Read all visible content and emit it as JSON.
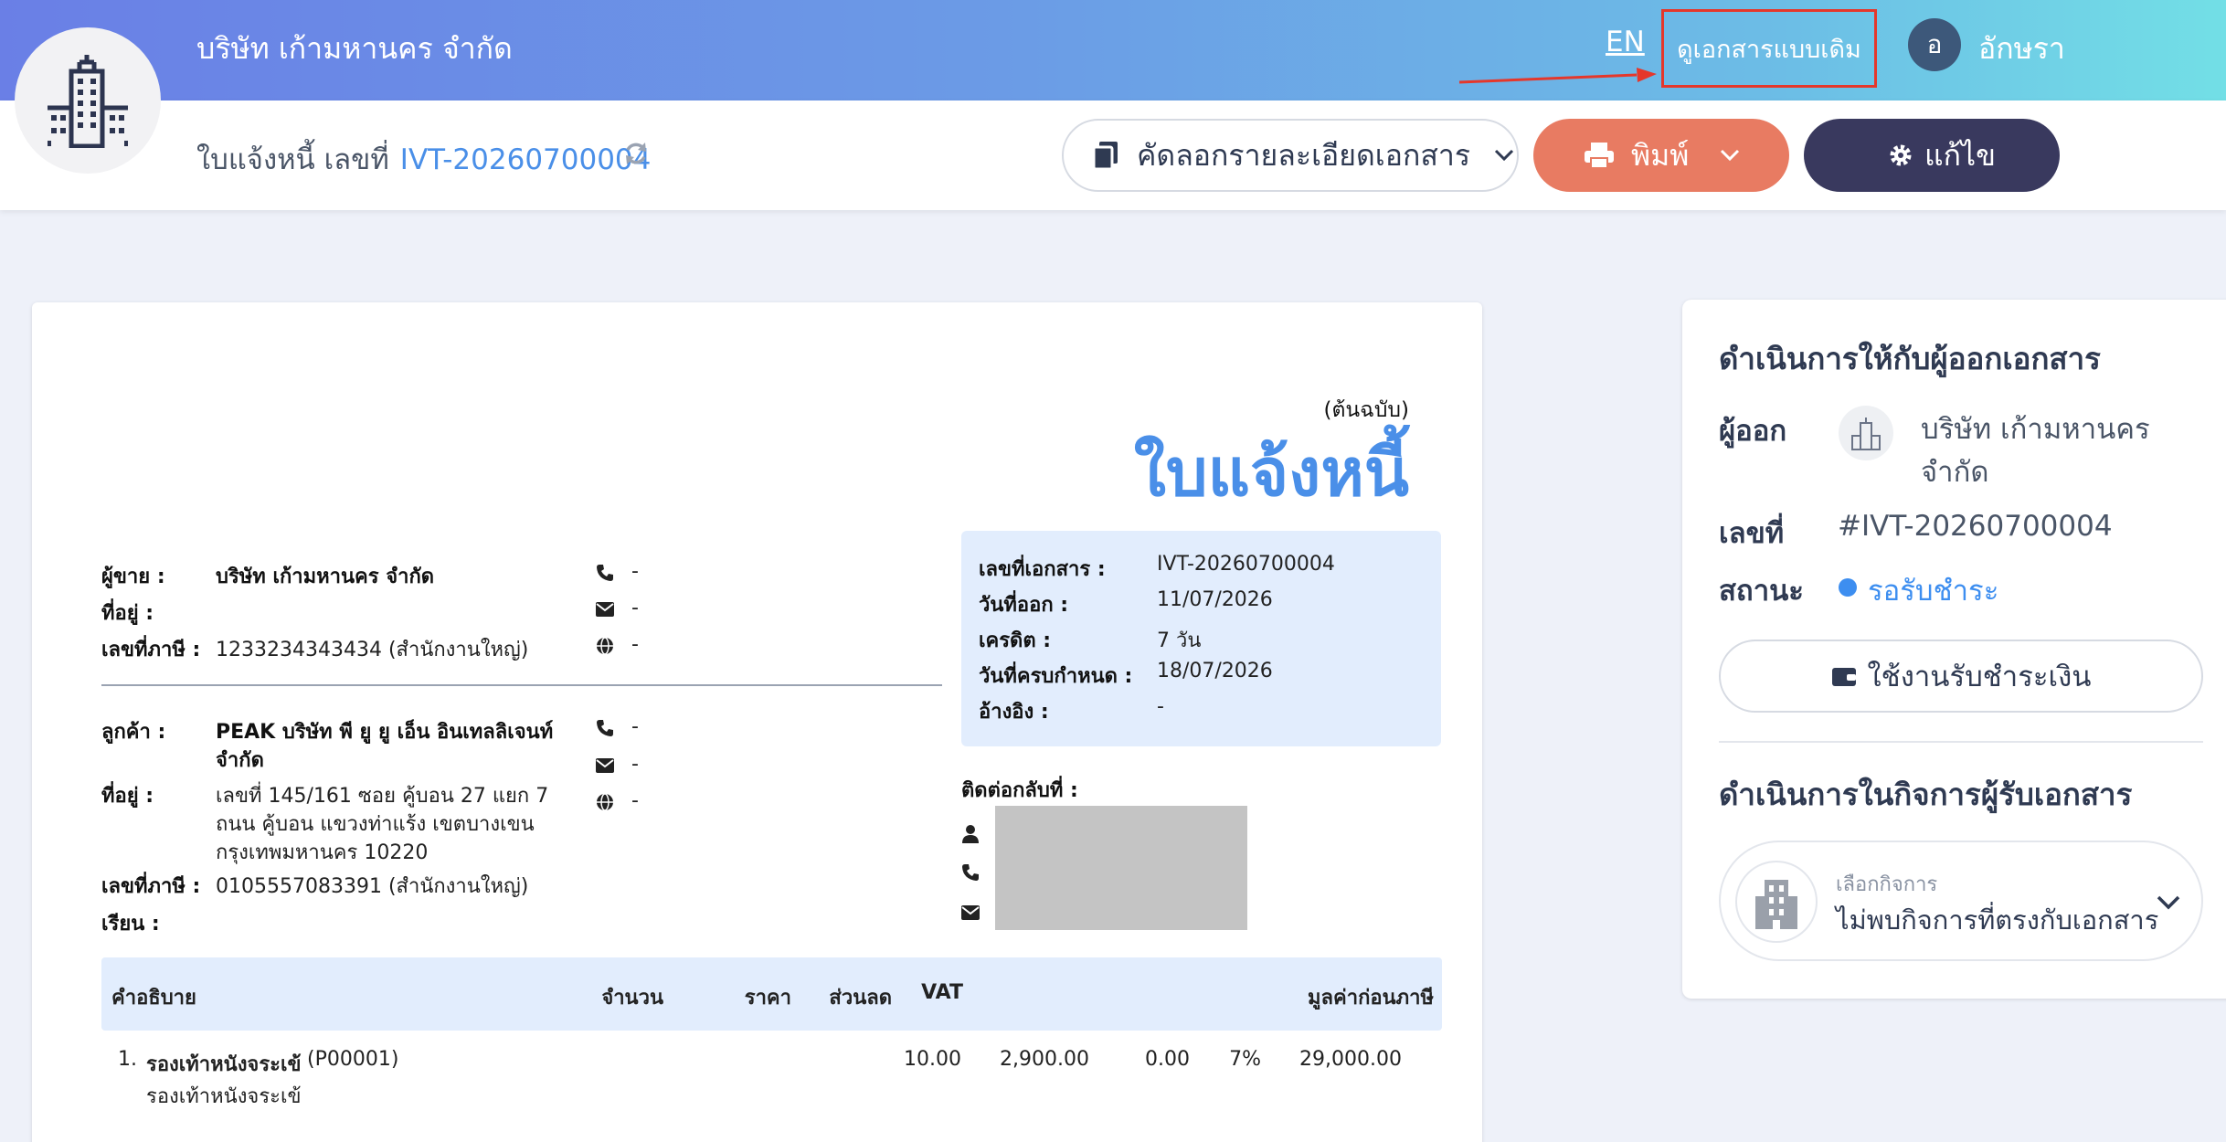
{
  "header": {
    "company_name": "บริษัท เก้ามหานคร จำกัด",
    "lang_link": "EN",
    "legacy_view_link": "ดูเอกสารแบบเดิม",
    "user_initial": "อ",
    "user_name": "อักษรา"
  },
  "subheader": {
    "doc_title": "ใบแจ้งหนี้ เลขที่",
    "doc_number": "IVT-20260700004",
    "copy_button": "คัดลอกรายละเอียดเอกสาร",
    "print_button": "พิมพ์",
    "edit_button": "แก้ไข"
  },
  "document": {
    "original_tag": "(ต้นฉบับ)",
    "title": "ใบแจ้งหนี้",
    "seller": {
      "seller_label": "ผู้ขาย :",
      "seller_name": "บริษัท เก้ามหานคร จำกัด",
      "address_label": "ที่อยู่ :",
      "tax_label": "เลขที่ภาษี :",
      "tax_id": "1233234343434 (สำนักงานใหญ่)",
      "phone": "-",
      "email": "-",
      "web": "-"
    },
    "customer": {
      "customer_label": "ลูกค้า :",
      "customer_name_1": "PEAK บริษัท พี ยู ยู เอ็น อินเทลลิเจนท์",
      "customer_name_2": "จำกัด",
      "address_label": "ที่อยู่ :",
      "address_1": "เลขที่ 145/161  ซอย คู้บอน 27 แยก 7",
      "address_2": "ถนน คู้บอน  แขวงท่าแร้ง เขตบางเขน",
      "address_3": "กรุงเทพมหานคร 10220",
      "tax_label": "เลขที่ภาษี :",
      "tax_id": "0105557083391 (สำนักงานใหญ่)",
      "attn_label": "เรียน :",
      "phone": "-",
      "email": "-",
      "web": "-"
    },
    "info": {
      "doc_no_label": "เลขที่เอกสาร :",
      "doc_no": "IVT-20260700004",
      "issue_label": "วันที่ออก :",
      "issue_date": "11/07/2026",
      "credit_label": "เครดิต :",
      "credit": "7 วัน",
      "due_label": "วันที่ครบกำหนด :",
      "due_date": "18/07/2026",
      "ref_label": "อ้างอิง :",
      "ref": "-"
    },
    "contact_label": "ติดต่อกลับที่ :",
    "table": {
      "headers": [
        "คำอธิบาย",
        "จำนวน",
        "ราคา",
        "ส่วนลด",
        "VAT",
        "มูลค่าก่อนภาษี"
      ],
      "rows": [
        {
          "index": "1.",
          "name": "รองเท้าหนังจระเข้",
          "code": "(P00001)",
          "description": "รองเท้าหนังจระเข้",
          "qty": "10.00",
          "price": "2,900.00",
          "discount": "0.00",
          "vat": "7%",
          "amount": "29,000.00"
        }
      ]
    }
  },
  "side": {
    "issuer_heading": "ดำเนินการให้กับผู้ออกเอกสาร",
    "issuer_label": "ผู้ออก",
    "issuer_name_1": "บริษัท เก้ามหานคร",
    "issuer_name_2": "จำกัด",
    "number_label": "เลขที่",
    "number_value": "#IVT-20260700004",
    "status_label": "สถานะ",
    "status_value": "รอรับชำระ",
    "payment_button": "ใช้งานรับชำระเงิน",
    "receiver_heading": "ดำเนินการในกิจการผู้รับเอกสาร",
    "select_label": "เลือกกิจการ",
    "select_value": "ไม่พบกิจการที่ตรงกับเอกสาร"
  },
  "colors": {
    "accent_blue": "#4a8fe8",
    "print_orange": "#e87b62",
    "edit_navy": "#39395e",
    "highlight_red": "#e5372b",
    "status_dot": "#3d8ef0"
  },
  "icons": [
    "building-icon",
    "refresh-icon",
    "copy-icon",
    "chevron-down-icon",
    "printer-icon",
    "gear-icon",
    "phone-icon",
    "mail-icon",
    "globe-icon",
    "user-icon",
    "wallet-icon",
    "arrow-icon"
  ]
}
